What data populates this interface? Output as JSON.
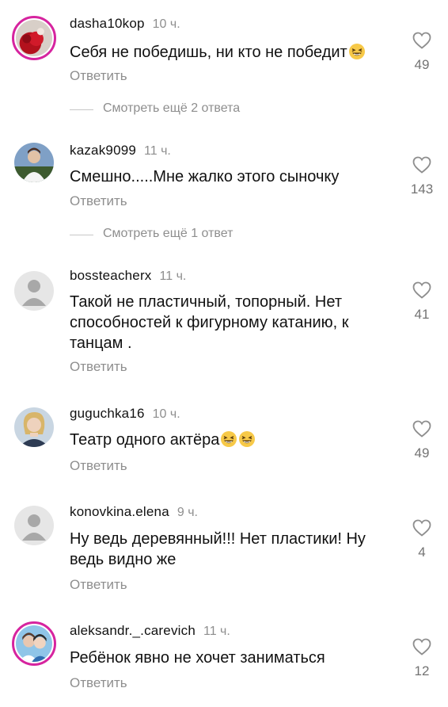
{
  "reply_label": "Ответить",
  "comments": [
    {
      "username": "dasha10kop",
      "time": "10 ч.",
      "text": "Себя не победишь, ни кто не победит",
      "likes": "49",
      "avatar": "photo-red-roses"
    },
    {
      "username": "kazak9099",
      "time": "11 ч.",
      "text": "Смешно.....Мне жалко этого сыночку",
      "likes": "143",
      "avatar": "photo-person"
    },
    {
      "username": "bossteacherx",
      "time": "11 ч.",
      "text": "Такой не пластичный, топорный. Нет способностей к фигурному катанию, к танцам .",
      "likes": "41",
      "avatar": "default-avatar"
    },
    {
      "username": "guguchka16",
      "time": "10 ч.",
      "text": "Театр одного актёра",
      "likes": "49",
      "avatar": "photo-woman"
    },
    {
      "username": "konovkina.elena",
      "time": "9 ч.",
      "text": "Ну ведь деревянный!!! Нет пластики! Ну ведь видно же",
      "likes": "4",
      "avatar": "default-avatar"
    },
    {
      "username": "aleksandr._.carevich",
      "time": "11 ч.",
      "text": "Ребёнок явно не хочет заниматься",
      "likes": "12",
      "avatar": "photo-two-people"
    }
  ],
  "view_more": [
    "Смотреть ещё 2 ответа",
    "Смотреть ещё 1 ответ"
  ],
  "icons": {
    "like": "heart-outline-icon",
    "emoji": "grinning-squinting-face-emoji"
  },
  "colors": {
    "story_ring": "#d6249f",
    "secondary_text": "#8e8e8e"
  }
}
